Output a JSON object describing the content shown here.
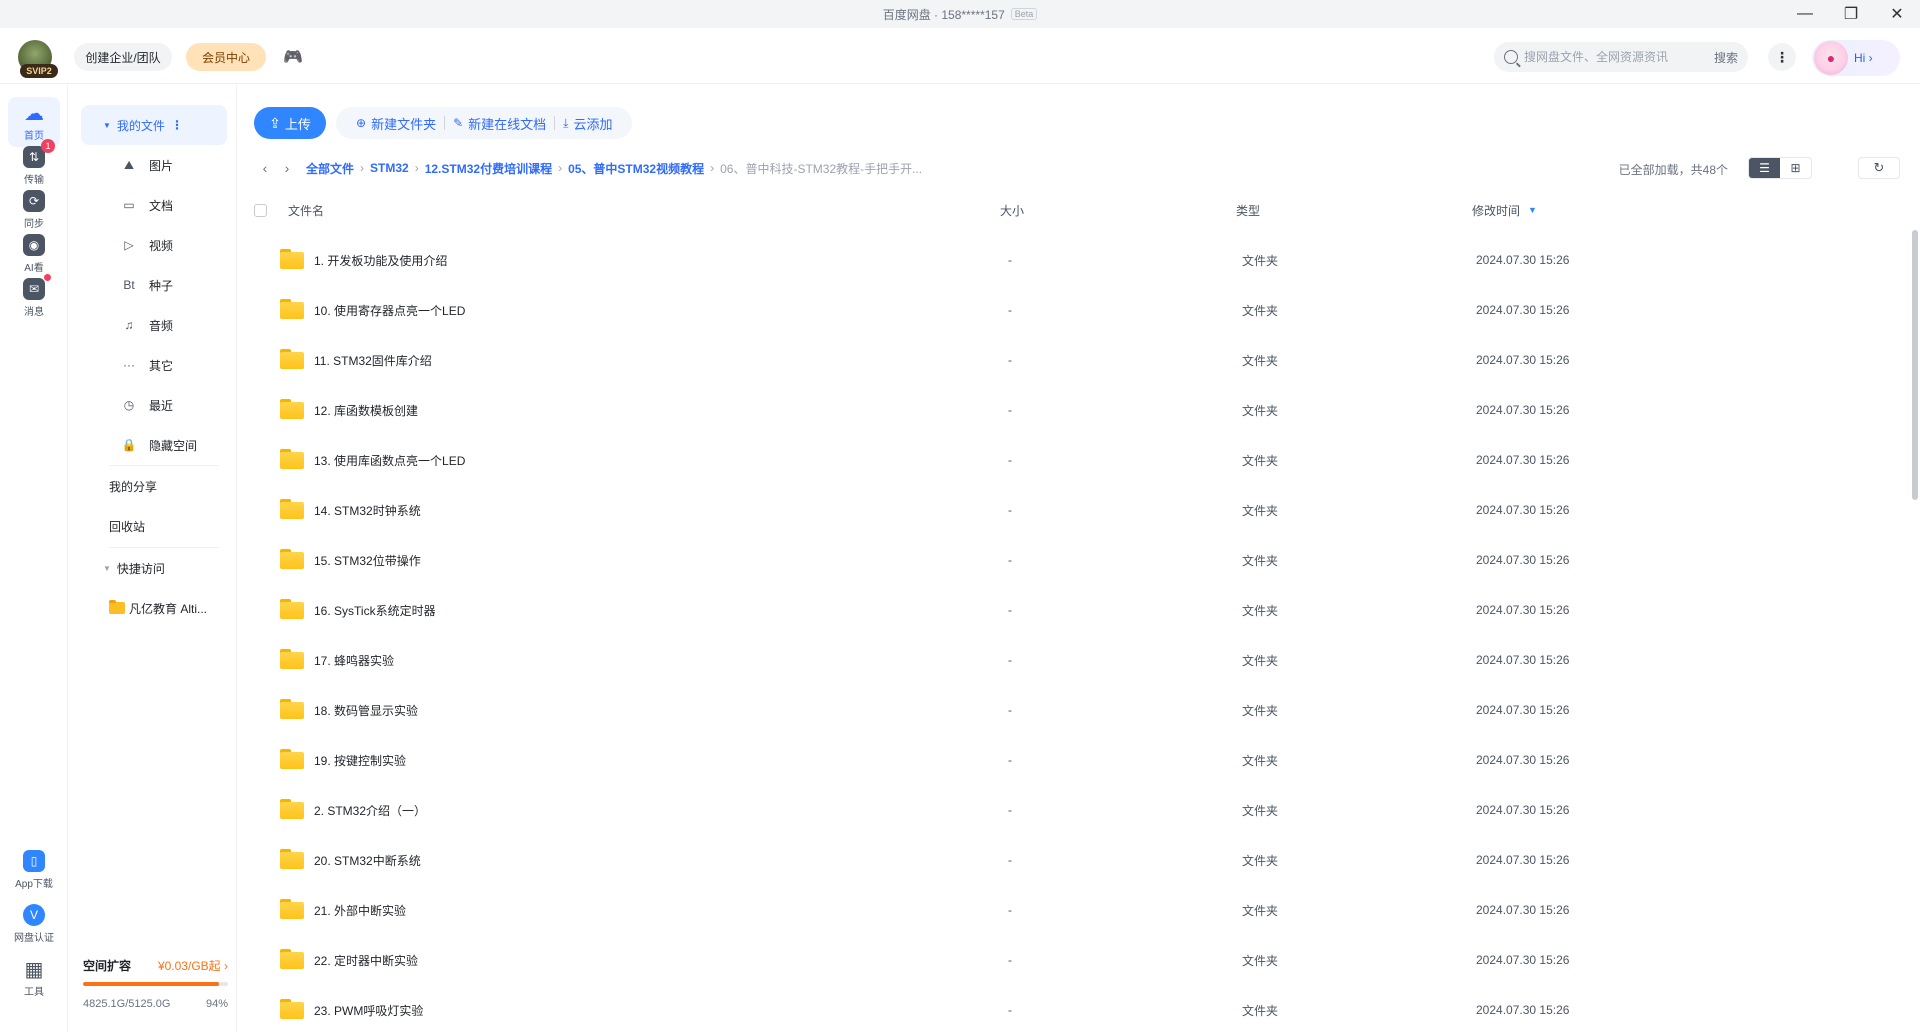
{
  "window": {
    "title": "百度网盘 · 158*****157",
    "beta": "Beta",
    "controls": {
      "minimize": "—",
      "restore": "❐",
      "close": "✕"
    }
  },
  "header": {
    "svip_badge": "SVIP2",
    "create_team": "创建企业/团队",
    "vip_center": "会员中心",
    "game_icon": "🎮",
    "search_placeholder": "搜网盘文件、全网资源资讯",
    "search_button": "搜索",
    "more": "⋮",
    "user_greeting": "Hi ›"
  },
  "rail": [
    {
      "label": "首页",
      "icon": "cloud-icon",
      "glyph": "☁",
      "active": true
    },
    {
      "label": "传输",
      "icon": "transfer-icon",
      "glyph": "⇅",
      "badge": "1"
    },
    {
      "label": "同步",
      "icon": "sync-icon",
      "glyph": "⟳"
    },
    {
      "label": "AI看",
      "icon": "ai-icon",
      "glyph": "◉"
    },
    {
      "label": "消息",
      "icon": "message-icon",
      "glyph": "✉",
      "dot": true
    }
  ],
  "rail_bottom": [
    {
      "label": "App下载",
      "icon": "app-download-icon",
      "glyph": "▯"
    },
    {
      "label": "网盘认证",
      "icon": "verify-icon",
      "glyph": "V"
    },
    {
      "label": "工具",
      "icon": "tools-icon",
      "glyph": "▦"
    }
  ],
  "nav": {
    "my_files": "我的文件",
    "kebab": "⋮",
    "caret": "▼",
    "categories": [
      {
        "label": "图片",
        "icon": "image-icon",
        "glyph": "⛰"
      },
      {
        "label": "文档",
        "icon": "document-icon",
        "glyph": "▭"
      },
      {
        "label": "视频",
        "icon": "video-icon",
        "glyph": "▷"
      },
      {
        "label": "种子",
        "icon": "torrent-icon",
        "glyph": "Bt"
      },
      {
        "label": "音频",
        "icon": "audio-icon",
        "glyph": "♫"
      },
      {
        "label": "其它",
        "icon": "other-icon",
        "glyph": "···"
      },
      {
        "label": "最近",
        "icon": "recent-icon",
        "glyph": "◷"
      },
      {
        "label": "隐藏空间",
        "icon": "lock-icon",
        "glyph": "🔒"
      }
    ],
    "my_share": "我的分享",
    "recycle": "回收站",
    "quick_access": "快捷访问",
    "quick_items": [
      "凡亿教育 Alti..."
    ]
  },
  "storage": {
    "title": "空间扩容",
    "price": "¥0.03/GB起 ›",
    "used": "4825.1G/5125.0G",
    "percent": "94%",
    "fill_fraction": 0.94
  },
  "toolbar": {
    "upload": "上传",
    "new_folder": "新建文件夹",
    "new_doc": "新建在线文档",
    "cloud_add": "云添加"
  },
  "breadcrumb": {
    "back": "‹",
    "forward": "›",
    "items": [
      "全部文件",
      "STM32",
      "12.STM32付费培训课程",
      "05、普中STM32视频教程",
      "06、普中科技-STM32教程-手把手开..."
    ],
    "loaded": "已全部加载，共48个"
  },
  "view": {
    "list": "☰",
    "grid": "⊞",
    "refresh": "↻"
  },
  "table": {
    "columns": {
      "name": "文件名",
      "size": "大小",
      "type": "类型",
      "modified": "修改时间"
    },
    "sort_icon": "▼",
    "rows": [
      {
        "name": "1. 开发板功能及使用介绍",
        "size": "-",
        "type": "文件夹",
        "modified": "2024.07.30 15:26"
      },
      {
        "name": "10. 使用寄存器点亮一个LED",
        "size": "-",
        "type": "文件夹",
        "modified": "2024.07.30 15:26"
      },
      {
        "name": "11. STM32固件库介绍",
        "size": "-",
        "type": "文件夹",
        "modified": "2024.07.30 15:26"
      },
      {
        "name": "12. 库函数模板创建",
        "size": "-",
        "type": "文件夹",
        "modified": "2024.07.30 15:26"
      },
      {
        "name": "13. 使用库函数点亮一个LED",
        "size": "-",
        "type": "文件夹",
        "modified": "2024.07.30 15:26"
      },
      {
        "name": "14. STM32时钟系统",
        "size": "-",
        "type": "文件夹",
        "modified": "2024.07.30 15:26"
      },
      {
        "name": "15. STM32位带操作",
        "size": "-",
        "type": "文件夹",
        "modified": "2024.07.30 15:26"
      },
      {
        "name": "16. SysTick系统定时器",
        "size": "-",
        "type": "文件夹",
        "modified": "2024.07.30 15:26"
      },
      {
        "name": "17. 蜂鸣器实验",
        "size": "-",
        "type": "文件夹",
        "modified": "2024.07.30 15:26"
      },
      {
        "name": "18. 数码管显示实验",
        "size": "-",
        "type": "文件夹",
        "modified": "2024.07.30 15:26"
      },
      {
        "name": "19. 按键控制实验",
        "size": "-",
        "type": "文件夹",
        "modified": "2024.07.30 15:26"
      },
      {
        "name": "2. STM32介绍（一）",
        "size": "-",
        "type": "文件夹",
        "modified": "2024.07.30 15:26"
      },
      {
        "name": "20. STM32中断系统",
        "size": "-",
        "type": "文件夹",
        "modified": "2024.07.30 15:26"
      },
      {
        "name": "21. 外部中断实验",
        "size": "-",
        "type": "文件夹",
        "modified": "2024.07.30 15:26"
      },
      {
        "name": "22. 定时器中断实验",
        "size": "-",
        "type": "文件夹",
        "modified": "2024.07.30 15:26"
      },
      {
        "name": "23. PWM呼吸灯实验",
        "size": "-",
        "type": "文件夹",
        "modified": "2024.07.30 15:26"
      }
    ]
  }
}
